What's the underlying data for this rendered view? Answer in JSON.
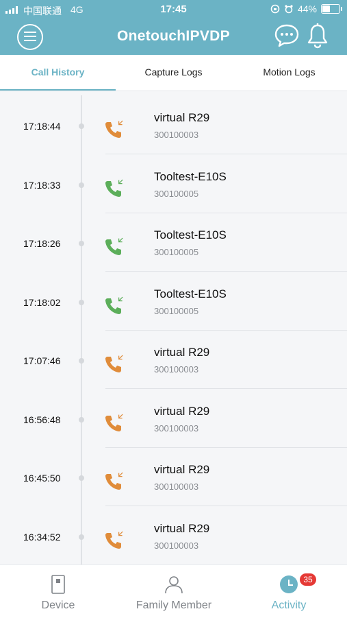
{
  "status_bar": {
    "carrier": "中国联通",
    "network": "4G",
    "time": "17:45",
    "battery": "44%"
  },
  "header": {
    "title": "OnetouchIPVDP"
  },
  "tabs": [
    {
      "label": "Call History",
      "active": true
    },
    {
      "label": "Capture Logs",
      "active": false
    },
    {
      "label": "Motion Logs",
      "active": false
    }
  ],
  "calls": [
    {
      "time": "17:18:44",
      "name": "virtual R29",
      "id": "300100003",
      "status_color": "#e08c3a"
    },
    {
      "time": "17:18:33",
      "name": "Tooltest-E10S",
      "id": "300100005",
      "status_color": "#5cae5a"
    },
    {
      "time": "17:18:26",
      "name": "Tooltest-E10S",
      "id": "300100005",
      "status_color": "#5cae5a"
    },
    {
      "time": "17:18:02",
      "name": "Tooltest-E10S",
      "id": "300100005",
      "status_color": "#5cae5a"
    },
    {
      "time": "17:07:46",
      "name": "virtual R29",
      "id": "300100003",
      "status_color": "#e08c3a"
    },
    {
      "time": "16:56:48",
      "name": "virtual R29",
      "id": "300100003",
      "status_color": "#e08c3a"
    },
    {
      "time": "16:45:50",
      "name": "virtual R29",
      "id": "300100003",
      "status_color": "#e08c3a"
    },
    {
      "time": "16:34:52",
      "name": "virtual R29",
      "id": "300100003",
      "status_color": "#e08c3a"
    }
  ],
  "bottom_nav": {
    "device": "Device",
    "family": "Family Member",
    "activity": "Activity",
    "activity_badge": "35"
  },
  "colors": {
    "accent": "#6bb3c5",
    "missed": "#e08c3a",
    "answered": "#5cae5a",
    "badge": "#e53935"
  }
}
